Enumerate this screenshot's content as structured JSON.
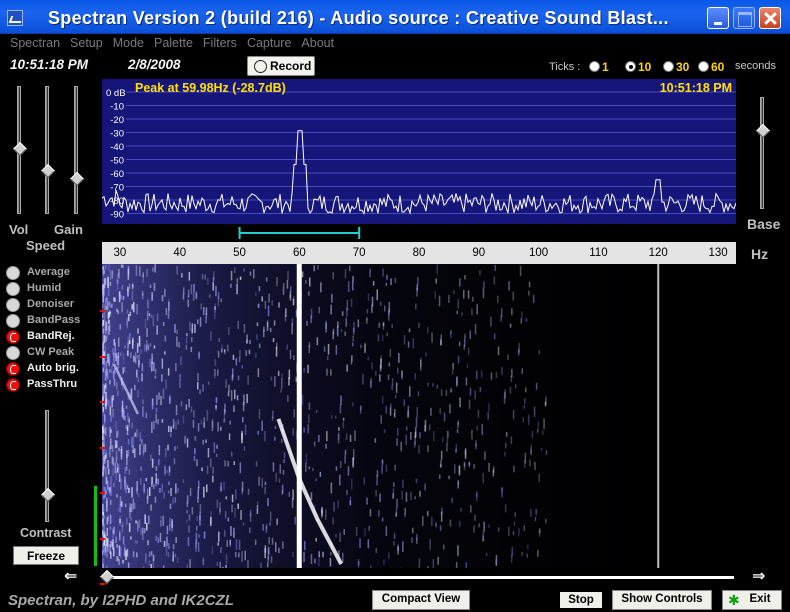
{
  "window": {
    "title": "Spectran Version 2 (build 216) - Audio source  :  Creative Sound Blast..."
  },
  "menu": [
    "Spectran",
    "Setup",
    "Mode",
    "Palette",
    "Filters",
    "Capture",
    "About"
  ],
  "status": {
    "time": "10:51:18 PM",
    "date": "2/8/2008"
  },
  "record_label": "Record",
  "ticks": {
    "label": "Ticks :",
    "options": [
      "1",
      "10",
      "30",
      "60"
    ],
    "selected": "10",
    "unit": "seconds"
  },
  "left_panel": {
    "vol_label": "Vol",
    "gain_label": "Gain",
    "speed_label": "Speed",
    "options": [
      {
        "label": "Average",
        "on": false
      },
      {
        "label": "Humid",
        "on": false
      },
      {
        "label": "Denoiser",
        "on": false
      },
      {
        "label": "BandPass",
        "on": false
      },
      {
        "label": "BandRej.",
        "on": true
      },
      {
        "label": "CW Peak",
        "on": false
      },
      {
        "label": "Auto brig.",
        "on": true
      },
      {
        "label": "PassThru",
        "on": true
      }
    ],
    "contrast_label": "Contrast",
    "freeze_label": "Freeze"
  },
  "right_panel": {
    "base_label": "Base",
    "hz_label": "Hz"
  },
  "spectrum": {
    "peak_text": "Peak at   59.98Hz (-28.7dB)",
    "time": "10:51:18 PM",
    "db_labels": [
      "0 dB",
      "-10",
      "-20",
      "-30",
      "-40",
      "-50",
      "-60",
      "-70",
      "-80",
      "-90"
    ]
  },
  "frequency_axis": {
    "labels": [
      "30",
      "40",
      "50",
      "60",
      "70",
      "80",
      "90",
      "100",
      "110",
      "120",
      "130"
    ],
    "passband": [
      50,
      70
    ]
  },
  "chart_data": {
    "type": "line",
    "xlim": [
      27,
      133
    ],
    "ylim": [
      -100,
      0
    ],
    "peaks": [
      {
        "x": 59.98,
        "y": -28.7
      },
      {
        "x": 120,
        "y": -65
      }
    ],
    "noise_floor": [
      -90,
      -75
    ]
  },
  "footer": {
    "credit": "Spectran, by I2PHD and IK2CZL",
    "compact_view": "Compact View",
    "stop": "Stop",
    "show_controls": "Show Controls",
    "exit": "Exit"
  },
  "colors": {
    "spectrum_bg": "#16167a",
    "trace": "#ffffff",
    "accent_yellow": "#ffe000",
    "passband_cyan": "#20d0d0"
  }
}
